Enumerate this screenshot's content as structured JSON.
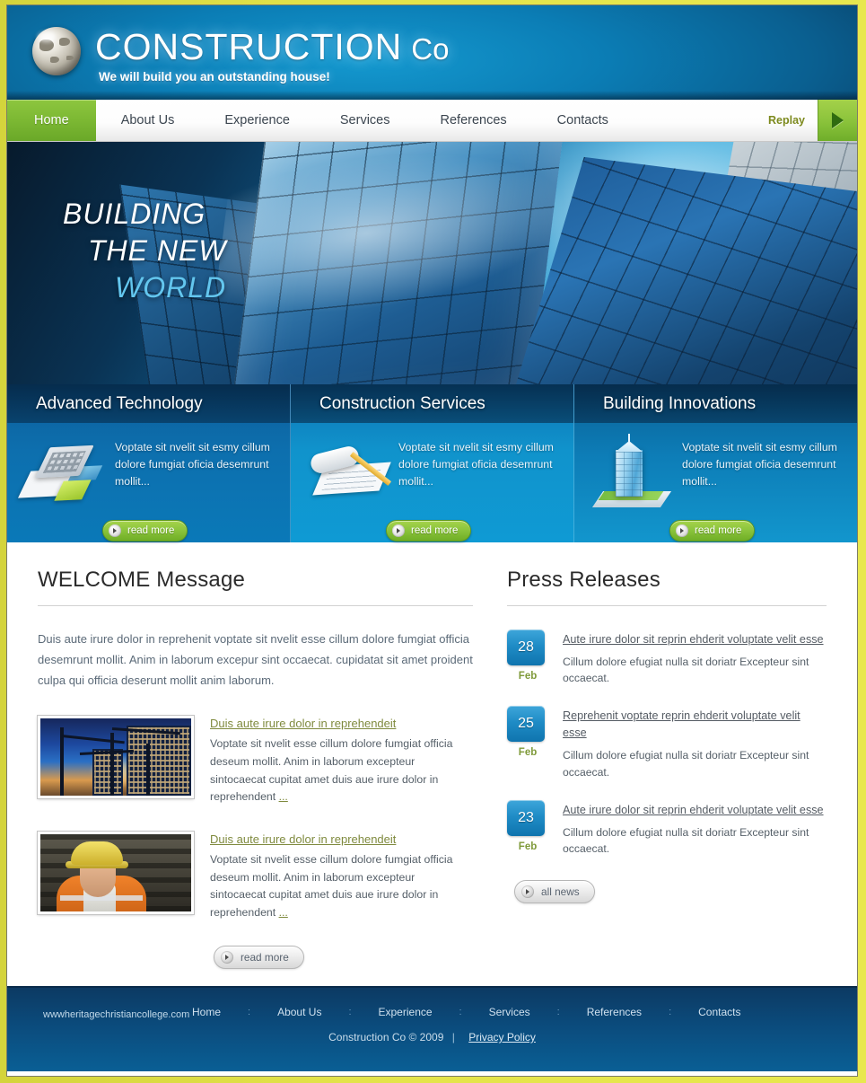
{
  "site": {
    "title": "CONSTRUCTION",
    "title_suffix": "Co",
    "tagline": "We will build you an outstanding house!",
    "logo_icon": "globe-icon"
  },
  "nav": {
    "items": [
      {
        "label": "Home",
        "active": true
      },
      {
        "label": "About Us",
        "active": false
      },
      {
        "label": "Experience",
        "active": false
      },
      {
        "label": "Services",
        "active": false
      },
      {
        "label": "References",
        "active": false
      },
      {
        "label": "Contacts",
        "active": false
      }
    ],
    "replay_label": "Replay",
    "play_icon": "play-triangle-icon"
  },
  "hero": {
    "line1": "BUILDING",
    "line2": "THE  NEW",
    "line3": "WORLD"
  },
  "features": [
    {
      "title": "Advanced Technology",
      "text": "Voptate sit nvelit sit esmy cillum dolore fumgiat oficia desemrunt mollit...",
      "button": "read more",
      "icon": "calculator-documents-icon"
    },
    {
      "title": "Construction Services",
      "text": "Voptate sit nvelit sit esmy cillum dolore fumgiat oficia desemrunt mollit...",
      "button": "read more",
      "icon": "blueprint-pencil-icon"
    },
    {
      "title": "Building Innovations",
      "text": "Voptate sit nvelit sit esmy cillum dolore fumgiat oficia desemrunt mollit...",
      "button": "read more",
      "icon": "glass-tower-icon"
    }
  ],
  "welcome": {
    "heading_strong": "WELCOME",
    "heading_rest": " Message",
    "paragraph": "Duis aute irure dolor in reprehenit voptate sit nvelit esse cillum dolore fumgiat officia desemrunt mollit.  Anim in laborum excepur sint occaecat. cupidatat sit amet proident culpa qui officia deserunt mollit anim laborum.",
    "articles": [
      {
        "title": "Duis aute irure dolor in reprehendeit",
        "text": "Voptate sit nvelit esse cillum dolore fumgiat officia deseum mollit.  Anim in laborum excepteur sintocaecat cupitat amet duis aue irure dolor in reprehendent ",
        "more": "...",
        "thumb": "construction-cranes-photo"
      },
      {
        "title": "Duis aute irure dolor in reprehendeit",
        "text": "Voptate sit nvelit esse cillum dolore fumgiat officia deseum mollit.  Anim in laborum excepteur sintocaecat cupitat amet duis aue irure dolor in reprehendent ",
        "more": "...",
        "thumb": "worker-hardhat-photo"
      }
    ],
    "button": "read more"
  },
  "press": {
    "heading": "Press Releases",
    "items": [
      {
        "day": "28",
        "month": "Feb",
        "title": "Aute irure dolor sit reprin ehderit voluptate velit esse",
        "text": "Cillum dolore efugiat nulla sit doriatr Excepteur sint occaecat."
      },
      {
        "day": "25",
        "month": "Feb",
        "title": "Reprehenit voptate reprin ehderit voluptate velit esse",
        "text": "Cillum dolore efugiat nulla sit doriatr Excepteur sint occaecat."
      },
      {
        "day": "23",
        "month": "Feb",
        "title": "Aute irure dolor sit reprin ehderit voluptate velit esse",
        "text": "Cillum dolore efugiat nulla sit doriatr Excepteur sint occaecat."
      }
    ],
    "button": "all news"
  },
  "footer": {
    "watermark": "wwwheritagechristiancollege.com",
    "links": [
      "Home",
      "About Us",
      "Experience",
      "Services",
      "References",
      "Contacts"
    ],
    "separator": ":",
    "copyright": "Construction Co © 2009",
    "privacy": "Privacy Policy"
  },
  "colors": {
    "accent_green": "#8cc53d",
    "brand_blue": "#0f74ae",
    "link_olive": "#7f8a3e",
    "frame_yellow": "#e3e34a"
  }
}
